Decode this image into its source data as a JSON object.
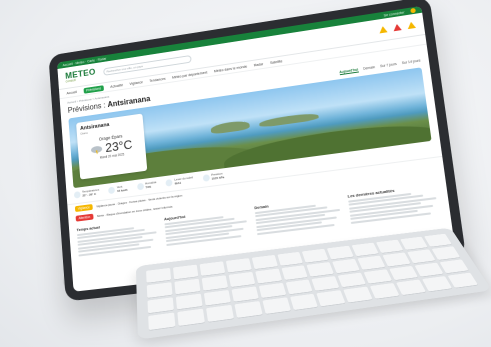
{
  "topstrip": {
    "left": "Accueil · Météo · Carte · Radar",
    "right": "Se connecter"
  },
  "header": {
    "logo_main": "METEO",
    "logo_sub": "consult",
    "search_placeholder": "Rechercher une ville, un pays",
    "alert_colors": [
      "#f5b700",
      "#e53935",
      "#f5b700"
    ]
  },
  "nav": {
    "items": [
      "Accueil",
      "Prévisions",
      "Actualité",
      "Vigilance",
      "Tendances",
      "Météo par département",
      "Météo dans le monde",
      "Radar",
      "Satellite"
    ],
    "active_index": 1
  },
  "breadcrumb": "Accueil > Prévisions > Antsiranana",
  "page": {
    "title_prefix": "Prévisions : ",
    "title_city": "Antsiranana",
    "tabs": [
      "Aujourd'hui",
      "Demain",
      "Sur 7 jours",
      "Sur 14 jours"
    ],
    "active_tab": 0
  },
  "weather_card": {
    "city": "Antsiranana",
    "region": "Diana",
    "condition": "Orage Épars",
    "temperature": "23°C",
    "date": "Mardi 20 mai 2025"
  },
  "stats": [
    {
      "label": "Températures",
      "value": "22° - 26° C"
    },
    {
      "label": "Vent",
      "value": "15 km/h"
    },
    {
      "label": "Humidité",
      "value": "74%"
    },
    {
      "label": "Lever du soleil",
      "value": "6h11"
    },
    {
      "label": "Pression",
      "value": "1015 hPa"
    }
  ],
  "vigilance": [
    {
      "label": "Vigilance",
      "color": "#f5b700",
      "text": "Vigilance jaune · Orages · Fortes pluies · Vents violents sur la région"
    },
    {
      "label": "Attention",
      "color": "#e53935",
      "text": "Alerte · Risque d'inondation en zone côtière, restez informés"
    }
  ],
  "columns": [
    {
      "title": "Temps actuel"
    },
    {
      "title": "Aujourd'hui"
    },
    {
      "title": "Demain"
    },
    {
      "title": "Les dernières actualités"
    }
  ]
}
